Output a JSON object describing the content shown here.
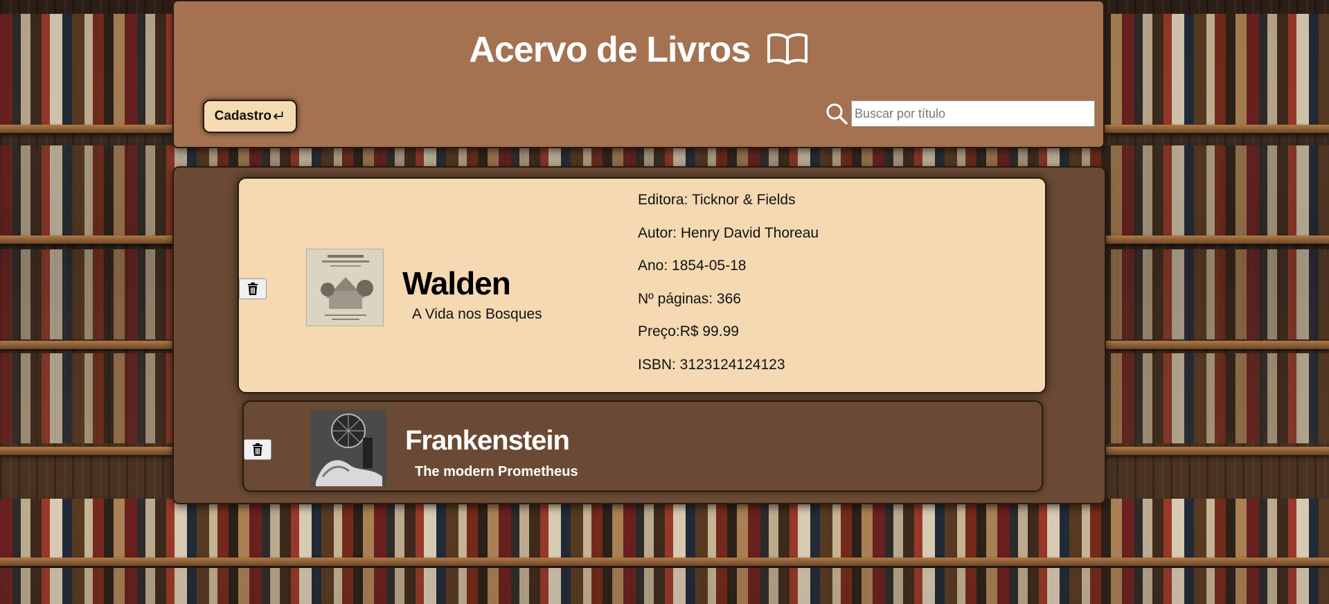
{
  "header": {
    "title": "Acervo de Livros",
    "title_icon": "open-book-icon",
    "register_button": "Cadastro",
    "register_icon": "enter-arrow-icon",
    "search_placeholder": "Buscar por título",
    "search_icon": "search-icon"
  },
  "books": [
    {
      "title": "Walden",
      "subtitle": "A Vida nos Bosques",
      "expanded": true,
      "details": {
        "editora": "Editora: Ticknor & Fields",
        "autor": "Autor: Henry David Thoreau",
        "ano": "Ano: 1854-05-18",
        "paginas": "Nº páginas: 366",
        "preco": "Preço:R$ 99.99",
        "isbn": "ISBN: 3123124124123"
      }
    },
    {
      "title": "Frankenstein",
      "subtitle": "The modern Prometheus",
      "expanded": false
    }
  ],
  "colors": {
    "header_bg": "#a47251",
    "main_bg": "#6a4a34",
    "card_expanded_bg": "#f4d9b2",
    "button_bg": "#f5dbb2"
  }
}
